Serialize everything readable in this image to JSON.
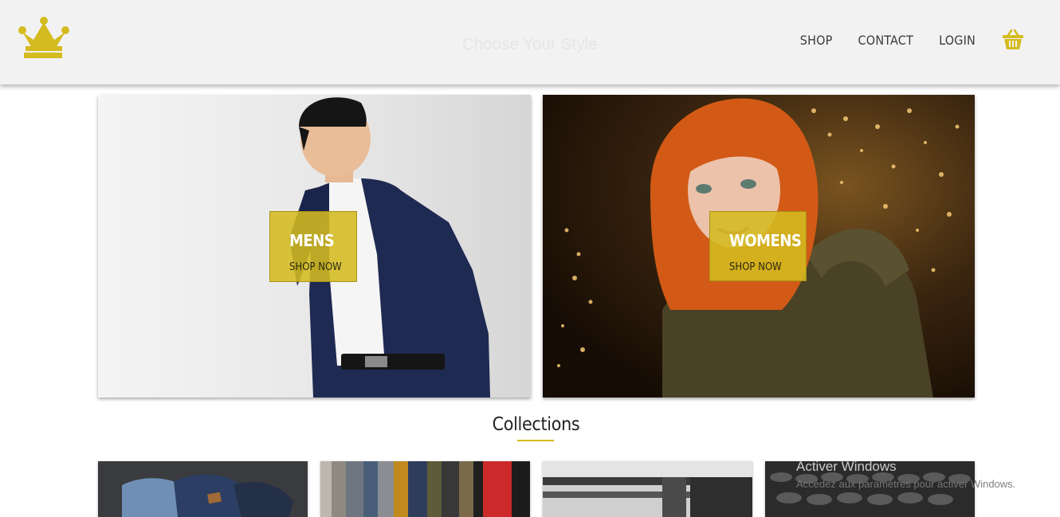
{
  "header": {
    "tagline": "Choose Your Style",
    "nav": [
      {
        "label": "SHOP"
      },
      {
        "label": "CONTACT"
      },
      {
        "label": "LOGIN"
      }
    ],
    "logo_icon": "crown-icon",
    "cart_icon": "basket-icon",
    "accent_color": "#d4bb20"
  },
  "hero": {
    "mens": {
      "title": "MENS",
      "cta": "SHOP NOW"
    },
    "womens": {
      "title": "WOMENS",
      "cta": "SHOP NOW"
    }
  },
  "collections": {
    "title": "Collections"
  },
  "watermark": {
    "line1": "Activer Windows",
    "line2": "Accédez aux paramètres pour activer Windows."
  }
}
